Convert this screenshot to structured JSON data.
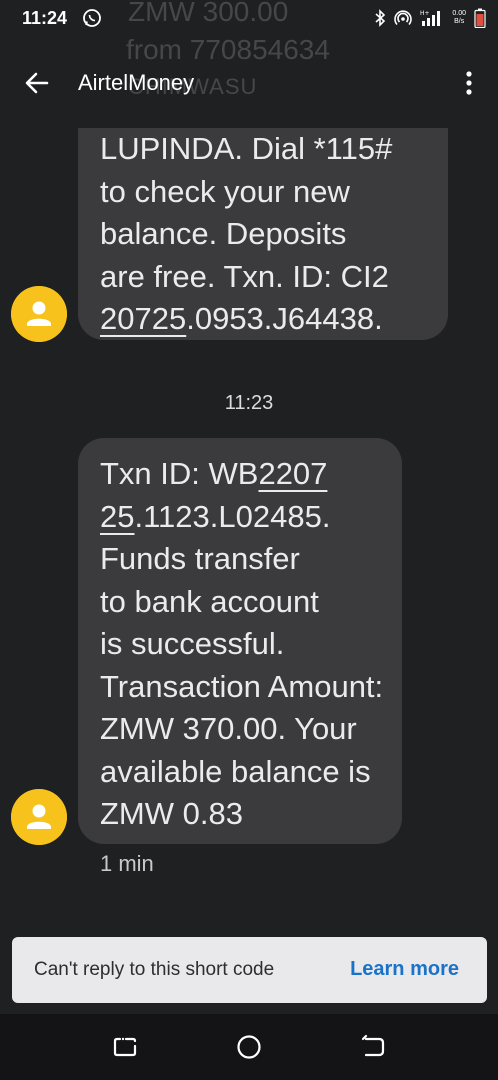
{
  "status_bar": {
    "time": "11:24",
    "net_speed_value": "0.00",
    "net_speed_unit": "B/s",
    "network_type": "H+",
    "background_notification_lines": [
      "ZMW 300.00",
      "from 770854634",
      "CHIMWASU"
    ]
  },
  "app_bar": {
    "title": "AirtelMoney"
  },
  "messages": [
    {
      "lines": [
        "LUPINDA. Dial *115#",
        "to check your new",
        "balance. Deposits",
        "are free. Txn. ID: CI2"
      ],
      "last_line_underlined": "20725",
      "last_line_rest": ".0953.J64438."
    },
    {
      "first_line_plain": "Txn ID: WB",
      "first_line_underlined": "2207",
      "second_line_underlined": "25",
      "second_line_rest": ".1123.L02485.",
      "lines": [
        "Funds transfer",
        "to bank account",
        "is successful.",
        "Transaction Amount:",
        "ZMW 370.00. Your",
        "available balance is",
        "ZMW 0.83"
      ]
    }
  ],
  "timestamp": "11:23",
  "last_message_meta": "1 min",
  "reply_banner": {
    "text": "Can't reply to this short code",
    "action": "Learn more"
  },
  "colors": {
    "background": "#1f2022",
    "bubble": "#3b3b3d",
    "avatar": "#f6c21b",
    "link": "#1a73c8"
  }
}
